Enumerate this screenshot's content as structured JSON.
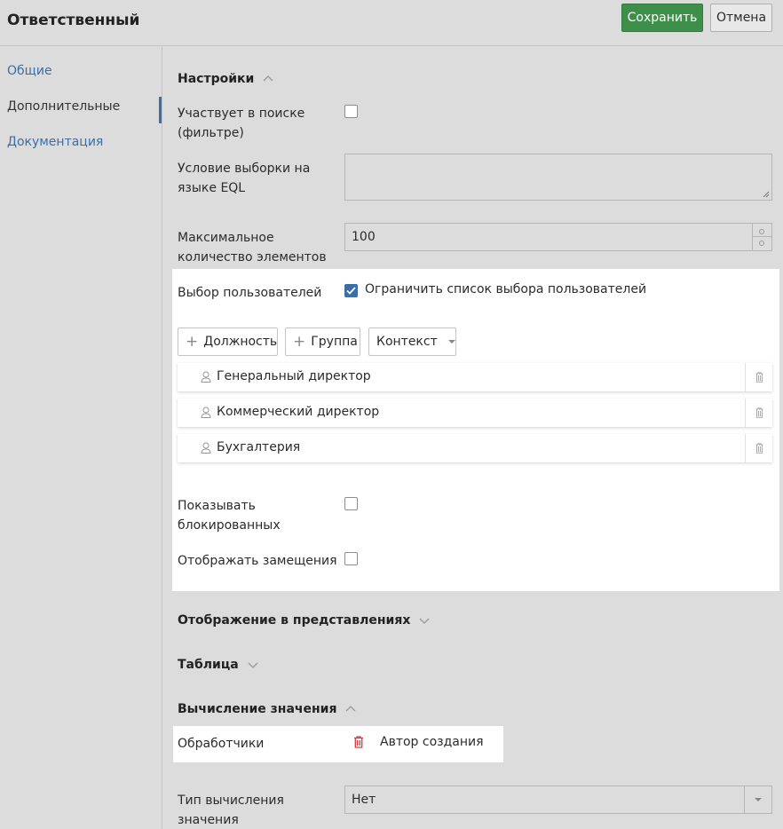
{
  "header": {
    "title": "Ответственный",
    "save_label": "Сохранить",
    "cancel_label": "Отмена"
  },
  "sidebar": {
    "items": [
      {
        "label": "Общие",
        "active": false
      },
      {
        "label": "Дополнительные",
        "active": true
      },
      {
        "label": "Документация",
        "active": false
      }
    ]
  },
  "settings": {
    "section_title": "Настройки",
    "search_filter_label": "Участвует в поиске (фильтре)",
    "search_filter_checked": false,
    "eql_label": "Условие выборки на языке EQL",
    "eql_value": "",
    "max_items_label": "Максимальное количество элементов",
    "max_items_value": "100",
    "user_select_label": "Выбор пользователей",
    "restrict_label": "Ограничить список выбора пользователей",
    "restrict_checked": true,
    "buttons": {
      "position": "Должность",
      "group": "Группа",
      "context": "Контекст"
    },
    "list": [
      {
        "name": "Генеральный директор",
        "icon": "user-icon"
      },
      {
        "name": "Коммерческий директор",
        "icon": "user-icon"
      },
      {
        "name": "Бухгалтерия",
        "icon": "user-icon"
      }
    ],
    "show_blocked_label": "Показывать блокированных",
    "show_blocked_checked": false,
    "show_substitutions_label": "Отображать замещения",
    "show_substitutions_checked": false
  },
  "views_section": {
    "title": "Отображение в представлениях"
  },
  "table_section": {
    "title": "Таблица"
  },
  "compute": {
    "section_title": "Вычисление значения",
    "handlers_label": "Обработчики",
    "handler_value": "Автор создания",
    "type_label": "Тип вычисления значения",
    "type_value": "Нет"
  },
  "colors": {
    "accent": "#3b6ea5",
    "save": "#3d8f49",
    "delete": "#d9363e"
  }
}
